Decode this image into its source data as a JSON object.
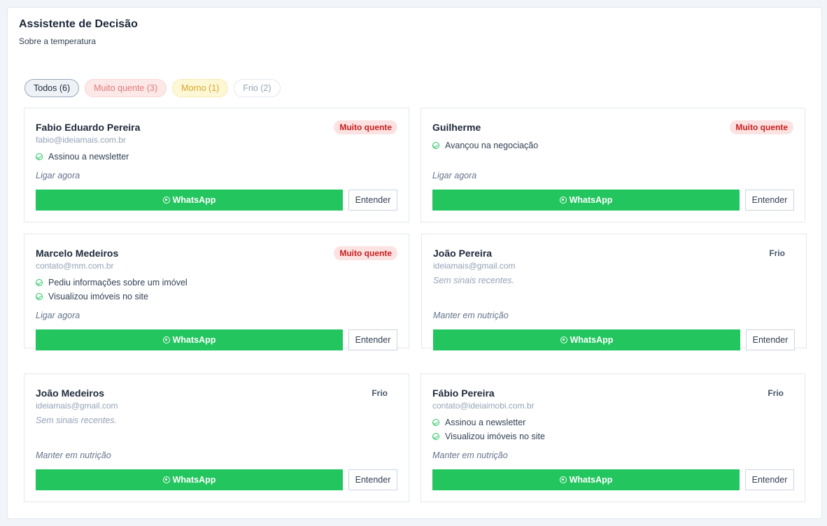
{
  "header": {
    "title": "Assistente de Decisão",
    "subtitle": "Sobre a temperatura"
  },
  "filters": [
    {
      "label": "Todos (6)",
      "variant": "all",
      "active": true
    },
    {
      "label": "Muito quente (3)",
      "variant": "hot"
    },
    {
      "label": "Morno (1)",
      "variant": "warm"
    },
    {
      "label": "Frio (2)",
      "variant": "cold"
    }
  ],
  "buttons": {
    "whatsapp": "WhatsApp",
    "entender": "Entender"
  },
  "leads": [
    {
      "name": "Fabio Eduardo Pereira",
      "email": "fabio@ideiamais.com.br",
      "badge": "Muito quente",
      "badge_variant": "hot",
      "signals": [
        "Assinou a newsletter"
      ],
      "action": "Ligar agora"
    },
    {
      "name": "Guilherme",
      "email": "",
      "badge": "Muito quente",
      "badge_variant": "hot",
      "signals": [
        "Avançou na negociação"
      ],
      "action": "Ligar agora"
    },
    {
      "name": "Marcelo Medeiros",
      "email": "contato@mm.com.br",
      "badge": "Muito quente",
      "badge_variant": "hot",
      "signals": [
        "Pediu informações sobre um imóvel",
        "Visualizou imóveis no site"
      ],
      "action": "Ligar agora"
    },
    {
      "name": "João Pereira",
      "email": "ideiamais@gmail.com",
      "badge": "Frio",
      "badge_variant": "cold",
      "signals": [],
      "no_signals": "Sem sinais recentes.",
      "action": "Manter em nutrição"
    },
    {
      "name": "João Medeiros",
      "email": "ideiamais@gmail.com",
      "badge": "Frio",
      "badge_variant": "cold",
      "signals": [],
      "no_signals": "Sem sinais recentes.",
      "action": "Manter em nutrição"
    },
    {
      "name": "Fábio Pereira",
      "email": "contato@ideiaimobi.com.br",
      "badge": "Frio",
      "badge_variant": "cold",
      "signals": [
        "Assinou a newsletter",
        "Visualizou imóveis no site"
      ],
      "action": "Manter em nutrição"
    }
  ],
  "colors": {
    "whatsapp_green": "#22c55e",
    "hot_badge_bg": "#fde2e2",
    "hot_badge_text": "#c81e1e"
  }
}
